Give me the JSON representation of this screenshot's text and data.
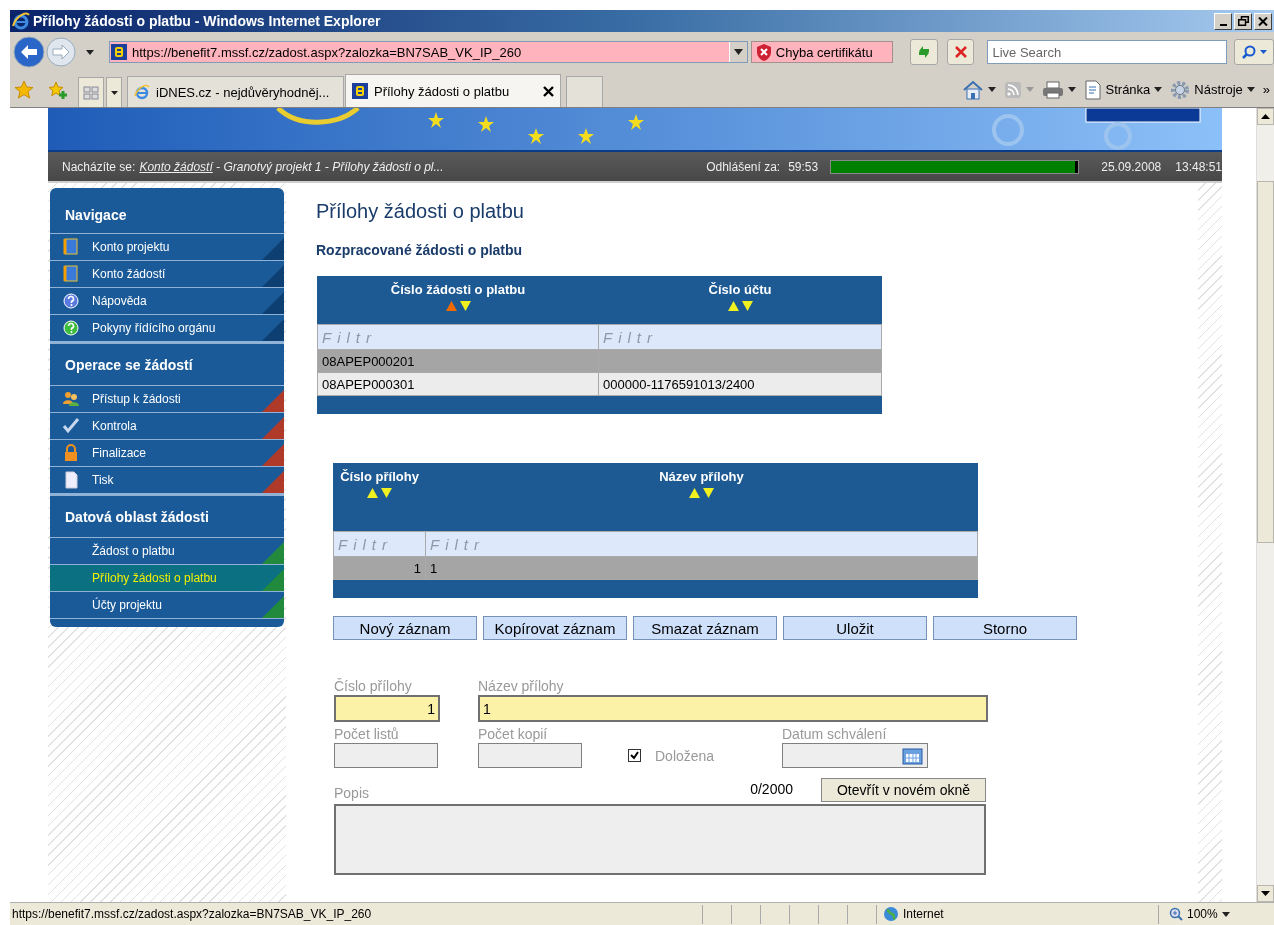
{
  "window": {
    "title": "Přílohy žádosti o platbu - Windows Internet Explorer"
  },
  "address_bar": {
    "url": "https://benefit7.mssf.cz/zadost.aspx?zalozka=BN7SAB_VK_IP_260",
    "certificate_error": "Chyba certifikátu"
  },
  "search": {
    "placeholder": "Live Search"
  },
  "tabs": [
    {
      "label": "iDNES.cz - nejdůvěryhodněj...",
      "selected": false
    },
    {
      "label": "Přílohy žádosti o platbu",
      "selected": true
    }
  ],
  "command_bar": {
    "items": [
      {
        "label": "Stránka"
      },
      {
        "label": "Nástroje"
      }
    ],
    "overflow": "»"
  },
  "breadcrumb": {
    "label": "Nacházíte se:",
    "link": "Konto žádostí",
    "rest": " - Granotvý projekt 1 - Přílohy žádosti o pl..."
  },
  "session": {
    "label": "Odhlášení za:",
    "remaining": "59:53",
    "level": 0.985,
    "date": "25.09.2008",
    "time": "13:48:51"
  },
  "sidebar": {
    "sections": [
      {
        "title": "Navigace",
        "color": "#0e3f72",
        "items": [
          {
            "label": "Konto projektu",
            "selected": false
          },
          {
            "label": "Konto žádostí",
            "selected": false
          },
          {
            "label": "Nápověda",
            "selected": false
          },
          {
            "label": "Pokyny řídícího orgánu",
            "selected": false
          }
        ]
      },
      {
        "title": "Operace se žádostí",
        "color": "#b03a2a",
        "items": [
          {
            "label": "Přístup k žádosti",
            "selected": false
          },
          {
            "label": "Kontrola",
            "selected": false
          },
          {
            "label": "Finalizace",
            "selected": false
          },
          {
            "label": "Tisk",
            "selected": false
          }
        ]
      },
      {
        "title": "Datová oblast žádosti",
        "color": "#218a3c",
        "items": [
          {
            "label": "Žádost o platbu",
            "selected": false
          },
          {
            "label": "Přílohy žádosti o platbu",
            "selected": true
          },
          {
            "label": "Účty projektu",
            "selected": false
          }
        ]
      }
    ]
  },
  "page": {
    "title": "Přílohy žádosti o platbu",
    "subtitle": "Rozpracované žádosti o platbu"
  },
  "requests_table": {
    "columns": [
      {
        "label": "Číslo žádosti o platbu",
        "sorted": true,
        "filter_placeholder": "Filtr",
        "kind": "text"
      },
      {
        "label": "Číslo účtu",
        "sorted": false,
        "filter_placeholder": "Filtr",
        "kind": "text"
      }
    ],
    "rows": [
      {
        "cells": [
          "08APEP000201"
        ],
        "selected": true
      },
      {
        "cells": [
          "08APEP000301",
          "000000-1176591013/2400"
        ],
        "selected": false
      }
    ]
  },
  "attachments_table": {
    "columns": [
      {
        "label": "Číslo přílohy",
        "sorted": false,
        "filter_placeholder": "Filtr",
        "kind": "number"
      },
      {
        "label": "Název přílohy",
        "sorted": false,
        "filter_placeholder": "Filtr",
        "kind": "text"
      }
    ],
    "rows": [
      {
        "cells": [
          "1",
          "1"
        ],
        "selected": true
      }
    ]
  },
  "buttons": [
    "Nový záznam",
    "Kopírovat záznam",
    "Smazat záznam",
    "Uložit",
    "Storno"
  ],
  "form": {
    "rows": [
      [
        {
          "kind": "number",
          "label": "Číslo přílohy",
          "value": "1",
          "required": true
        },
        {
          "kind": "text",
          "label": "Název přílohy",
          "value": "1",
          "required": true
        }
      ],
      [
        {
          "kind": "count",
          "label": "Počet listů",
          "required": false
        },
        {
          "kind": "count",
          "label": "Počet kopií",
          "required": false
        },
        {
          "kind": "checkbox",
          "label": "Doložena",
          "checked": true
        },
        {
          "kind": "date",
          "label": "Datum schválení",
          "required": false
        }
      ]
    ],
    "description": {
      "label": "Popis",
      "counter": "0/2000",
      "open_button": "Otevřít v novém okně"
    }
  },
  "status_bar": {
    "url": "https://benefit7.mssf.cz/zadost.aspx?zalozka=BN7SAB_VK_IP_260",
    "zone": "Internet",
    "zoom": "100%"
  }
}
